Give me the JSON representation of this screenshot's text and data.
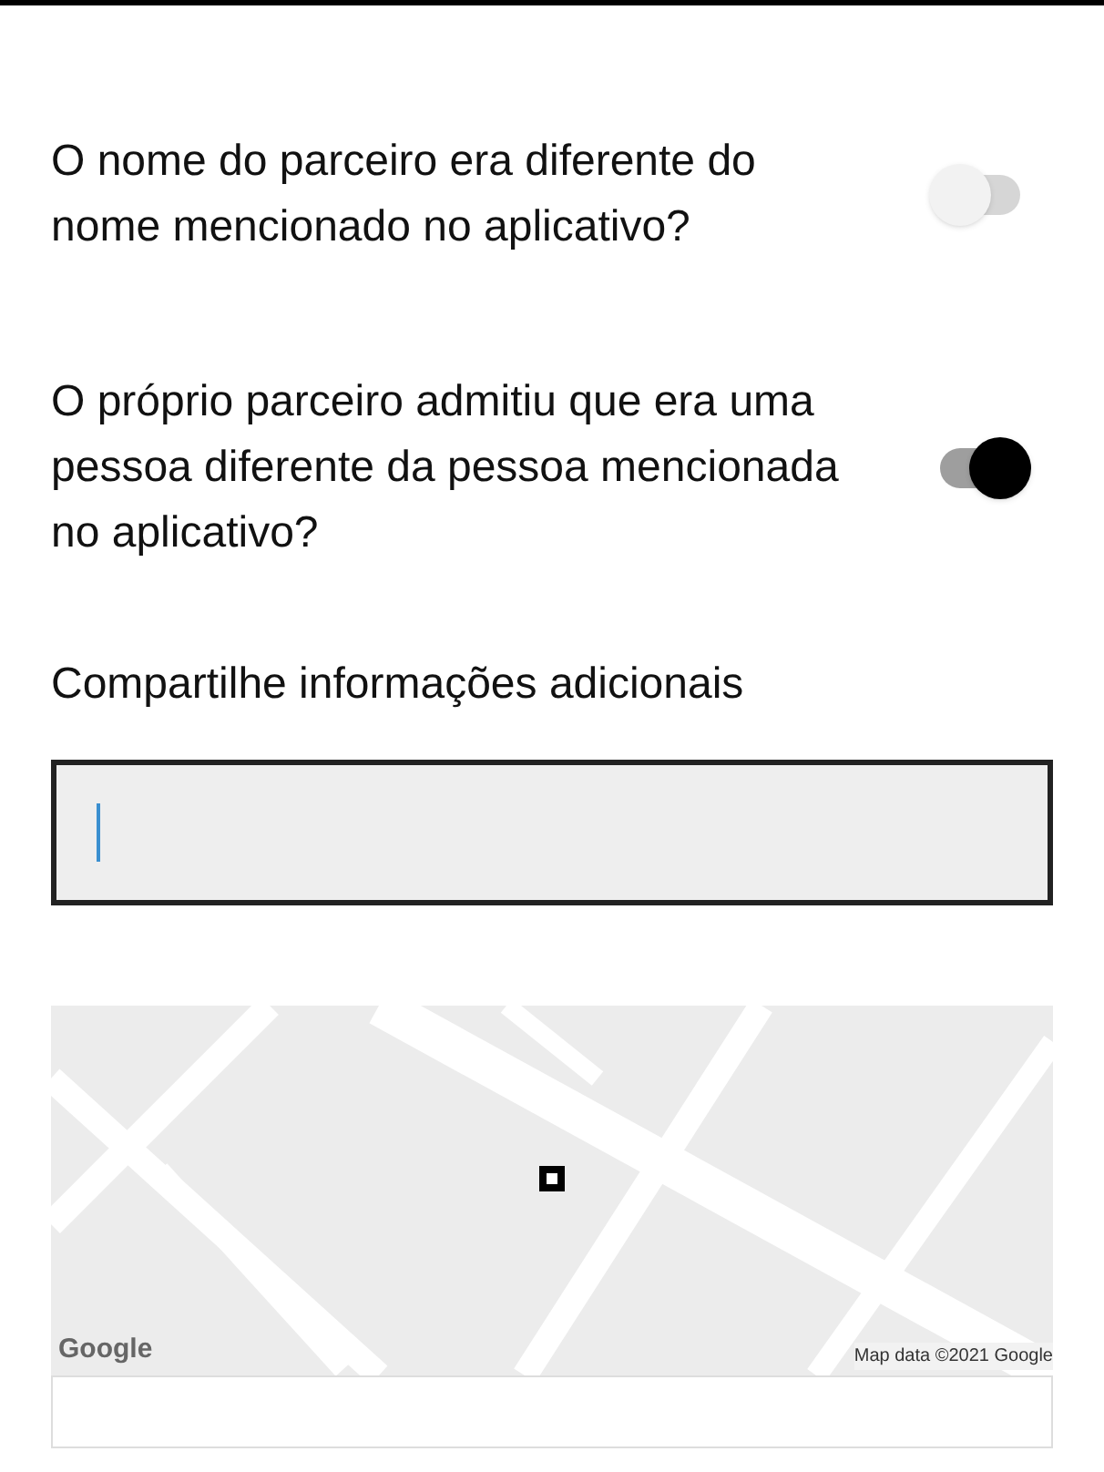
{
  "questions": [
    {
      "text": "O nome do parceiro era diferente do nome mencionado no aplicativo?",
      "on": false
    },
    {
      "text": "O próprio parceiro admitiu que era uma pessoa diferente da pessoa mencionada no aplicativo?",
      "on": true
    }
  ],
  "comment": {
    "label": "Compartilhe informações adicionais"
  },
  "map": {
    "kind": "picture",
    "logo": "Google",
    "attribution": "Map data ©2021 Google"
  }
}
